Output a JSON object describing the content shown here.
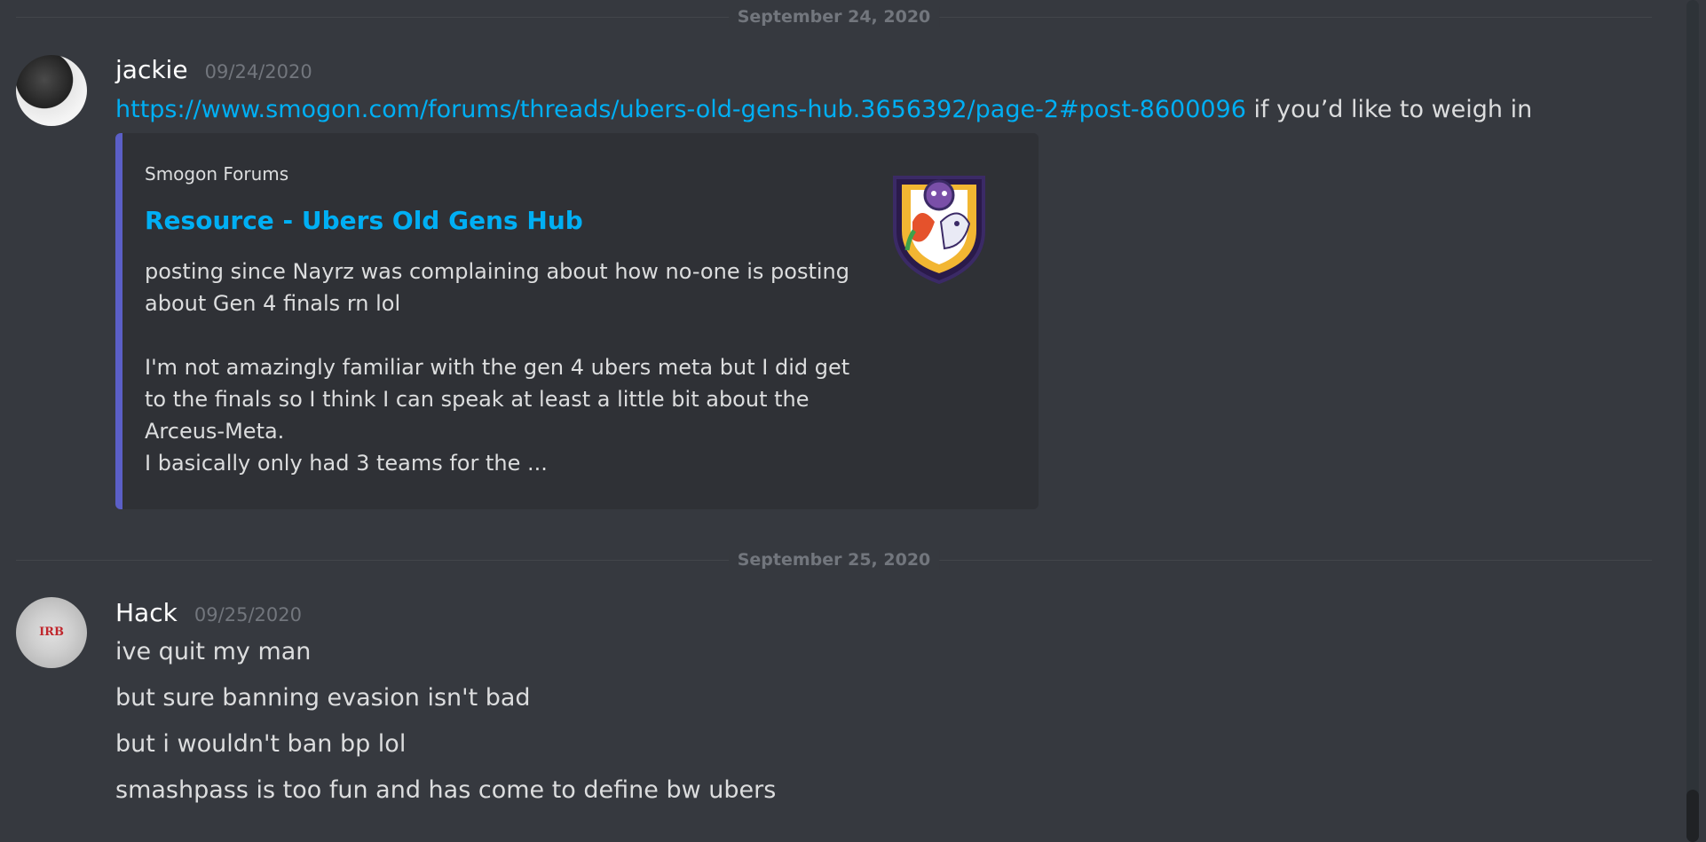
{
  "dividers": [
    {
      "label": "September 24, 2020"
    },
    {
      "label": "September 25, 2020"
    }
  ],
  "messages": [
    {
      "username": "jackie",
      "timestamp": "09/24/2020",
      "lines": [
        {
          "link": "https://www.smogon.com/forums/threads/ubers-old-gens-hub.3656392/page-2#post-8600096",
          "text": " if you’d like to weigh in"
        }
      ],
      "embed": {
        "provider": "Smogon Forums",
        "title": "Resource - Ubers Old Gens Hub",
        "description": "posting since Nayrz was complaining about how no-one is posting\nabout Gen 4 finals rn lol\n\nI'm not amazingly familiar with the gen 4 ubers meta but I did get\nto the finals so I think I can speak at least a little bit about the\nArceus-Meta.\nI basically only had 3 teams for the ...",
        "accent_color": "#5b5fc7",
        "thumbnail_icon": "smogon-crest-icon"
      }
    },
    {
      "username": "Hack",
      "timestamp": "09/25/2020",
      "avatar_emblem": "IRB",
      "lines": [
        {
          "text": "ive quit my man"
        },
        {
          "text": "but sure banning evasion isn't bad"
        },
        {
          "text": "but i wouldn't ban bp lol"
        },
        {
          "text": "smashpass is too fun and has come to define bw ubers"
        }
      ]
    }
  ],
  "colors": {
    "background": "#36393f",
    "link": "#00aff4",
    "muted": "#72767d",
    "embed_bg": "#2f3136"
  }
}
